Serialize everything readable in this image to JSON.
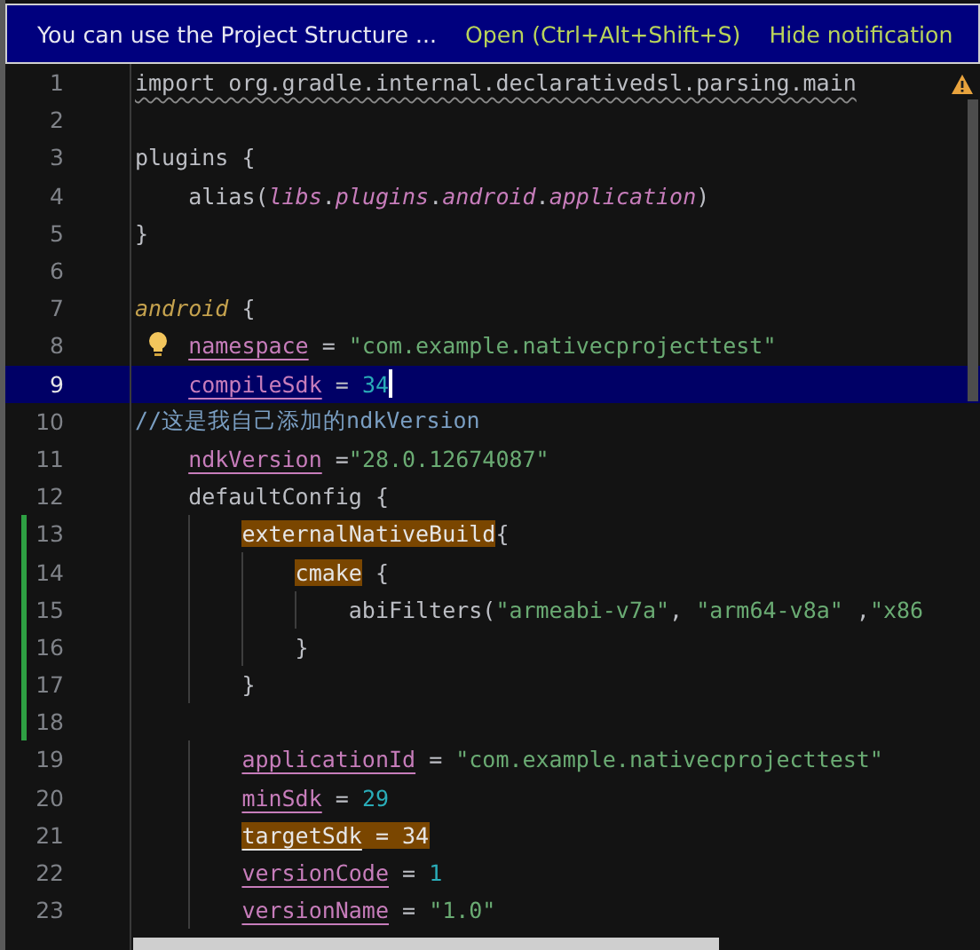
{
  "notification": {
    "message": "You can use the Project Structure ...",
    "actions": [
      "Open (Ctrl+Alt+Shift+S)",
      "Hide notification"
    ]
  },
  "lines": [
    {
      "number": "1",
      "current": false,
      "changed": false,
      "hint": false,
      "tokens": [
        {
          "text": "import org.gradle.internal.declarativedsl.parsing.main",
          "kind": "warn"
        }
      ]
    },
    {
      "number": "2",
      "current": false,
      "changed": false,
      "hint": false
    },
    {
      "number": "3",
      "current": false,
      "changed": false,
      "hint": false,
      "tokens": [
        {
          "text": "plugins {",
          "kind": "plain"
        }
      ]
    },
    {
      "number": "4",
      "current": false,
      "changed": false,
      "hint": false,
      "tokens": [
        {
          "text": "    alias(",
          "kind": "plain"
        },
        {
          "text": "libs",
          "kind": "member"
        },
        {
          "text": ".",
          "kind": "plain"
        },
        {
          "text": "plugins",
          "kind": "member"
        },
        {
          "text": ".",
          "kind": "plain"
        },
        {
          "text": "android",
          "kind": "member"
        },
        {
          "text": ".",
          "kind": "plain"
        },
        {
          "text": "application",
          "kind": "member"
        },
        {
          "text": ")",
          "kind": "plain"
        }
      ]
    },
    {
      "number": "5",
      "current": false,
      "changed": false,
      "hint": false,
      "tokens": [
        {
          "text": "}",
          "kind": "plain"
        }
      ]
    },
    {
      "number": "6",
      "current": false,
      "changed": false,
      "hint": false
    },
    {
      "number": "7",
      "current": false,
      "changed": false,
      "hint": false,
      "tokens": [
        {
          "text": "android",
          "kind": "call"
        },
        {
          "text": " {",
          "kind": "plain"
        }
      ]
    },
    {
      "number": "8",
      "current": false,
      "changed": false,
      "hint": true,
      "tokens": [
        {
          "text": "    namespace",
          "kind": "prop"
        },
        {
          "text": " = ",
          "kind": "plain"
        },
        {
          "text": "\"com.example.nativecprojecttest\"",
          "kind": "string"
        }
      ]
    },
    {
      "number": "9",
      "current": true,
      "changed": false,
      "hint": false,
      "tokens": [
        {
          "text": "    compileSdk",
          "kind": "prop"
        },
        {
          "text": " = ",
          "kind": "plain"
        },
        {
          "text": "34",
          "kind": "number"
        }
      ]
    },
    {
      "number": "10",
      "current": false,
      "changed": false,
      "hint": false,
      "tokens": [
        {
          "text": "//这是我自己添加的ndkVersion",
          "kind": "comment"
        }
      ]
    },
    {
      "number": "11",
      "current": false,
      "changed": false,
      "hint": false,
      "tokens": [
        {
          "text": "    ndkVersion",
          "kind": "prop"
        },
        {
          "text": " =",
          "kind": "plain"
        },
        {
          "text": "\"28.0.12674087\"",
          "kind": "string"
        }
      ]
    },
    {
      "number": "12",
      "current": false,
      "changed": false,
      "hint": false,
      "tokens": [
        {
          "text": "    defaultConfig {",
          "kind": "plain"
        }
      ]
    },
    {
      "number": "13",
      "current": false,
      "changed": true,
      "hint": false,
      "tokens": [
        {
          "text": "        externalNativeBuild",
          "kind": "match"
        },
        {
          "text": "{",
          "kind": "plain"
        }
      ]
    },
    {
      "number": "14",
      "current": false,
      "changed": true,
      "hint": false,
      "tokens": [
        {
          "text": "            cmake",
          "kind": "match"
        },
        {
          "text": " {",
          "kind": "plain"
        }
      ]
    },
    {
      "number": "15",
      "current": false,
      "changed": true,
      "hint": false,
      "tokens": [
        {
          "text": "                abiFilters(",
          "kind": "plain"
        },
        {
          "text": "\"armeabi-v7a\"",
          "kind": "string"
        },
        {
          "text": ", ",
          "kind": "plain"
        },
        {
          "text": "\"arm64-v8a\"",
          "kind": "string"
        },
        {
          "text": " ,",
          "kind": "plain"
        },
        {
          "text": "\"x86",
          "kind": "string"
        }
      ]
    },
    {
      "number": "16",
      "current": false,
      "changed": true,
      "hint": false,
      "tokens": [
        {
          "text": "            }",
          "kind": "plain"
        }
      ]
    },
    {
      "number": "17",
      "current": false,
      "changed": true,
      "hint": false,
      "tokens": [
        {
          "text": "        }",
          "kind": "plain"
        }
      ]
    },
    {
      "number": "18",
      "current": false,
      "changed": true,
      "hint": false
    },
    {
      "number": "19",
      "current": false,
      "changed": false,
      "hint": false,
      "tokens": [
        {
          "text": "        applicationId",
          "kind": "prop"
        },
        {
          "text": " = ",
          "kind": "plain"
        },
        {
          "text": "\"com.example.nativecprojecttest\"",
          "kind": "string"
        }
      ]
    },
    {
      "number": "20",
      "current": false,
      "changed": false,
      "hint": false,
      "tokens": [
        {
          "text": "        minSdk",
          "kind": "prop"
        },
        {
          "text": " = ",
          "kind": "plain"
        },
        {
          "text": "29",
          "kind": "number"
        }
      ]
    },
    {
      "number": "21",
      "current": false,
      "changed": false,
      "hint": false,
      "tokens": [
        {
          "text": "        targetSdk",
          "kind": "match-prop"
        },
        {
          "text": " = 34",
          "kind": "match"
        }
      ]
    },
    {
      "number": "22",
      "current": false,
      "changed": false,
      "hint": false,
      "tokens": [
        {
          "text": "        versionCode",
          "kind": "prop"
        },
        {
          "text": " = ",
          "kind": "plain"
        },
        {
          "text": "1",
          "kind": "number"
        }
      ]
    },
    {
      "number": "23",
      "current": false,
      "changed": false,
      "hint": false,
      "tokens": [
        {
          "text": "        versionName",
          "kind": "prop"
        },
        {
          "text": " = ",
          "kind": "plain"
        },
        {
          "text": "\"1.0\"",
          "kind": "string"
        }
      ]
    }
  ]
}
